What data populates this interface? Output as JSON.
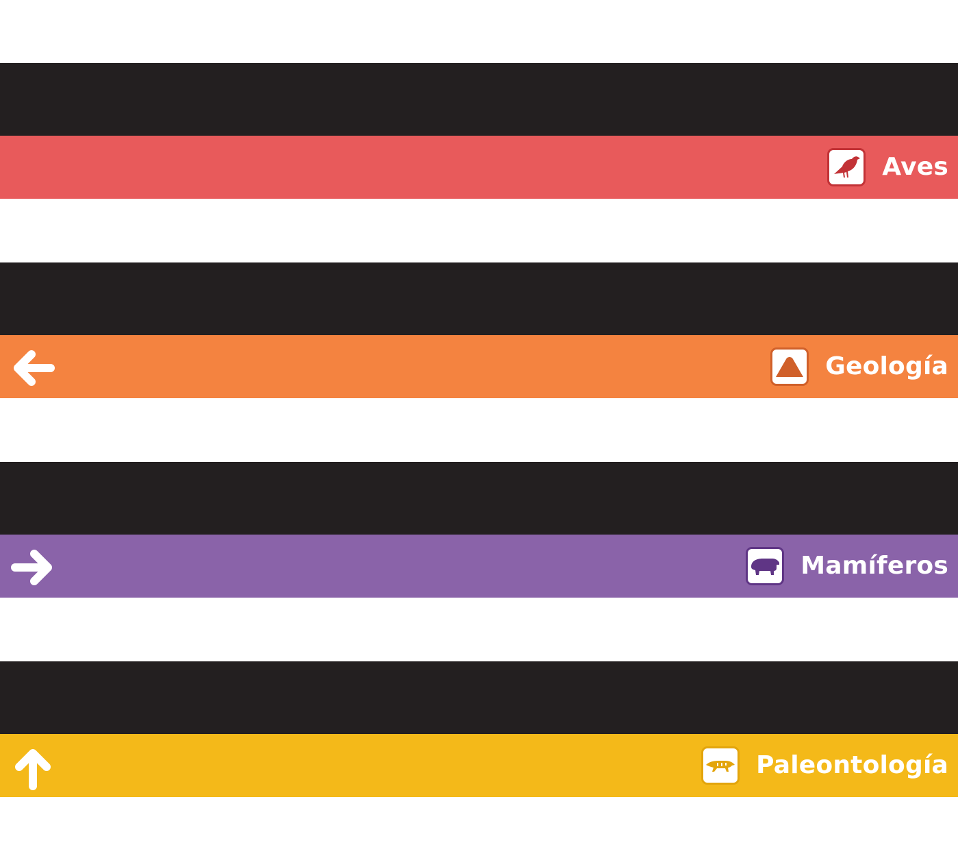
{
  "signs": [
    {
      "label": "Aves",
      "icon": "bird-icon",
      "arrow": null,
      "color": "#e85a5b",
      "icon_color": "#c23236"
    },
    {
      "label": "Geología",
      "icon": "volcano-icon",
      "arrow": "left-arrow-icon",
      "color": "#f48340",
      "icon_color": "#d0602a"
    },
    {
      "label": "Mamíferos",
      "icon": "tapir-icon",
      "arrow": "right-arrow-icon",
      "color": "#8a63a9",
      "icon_color": "#5f3585"
    },
    {
      "label": "Paleontología",
      "icon": "fossil-animal-icon",
      "arrow": "up-arrow-icon",
      "color": "#f4b919",
      "icon_color": "#e3a50c"
    }
  ],
  "colors": {
    "top_bar": "#231f20",
    "background": "#ffffff"
  }
}
